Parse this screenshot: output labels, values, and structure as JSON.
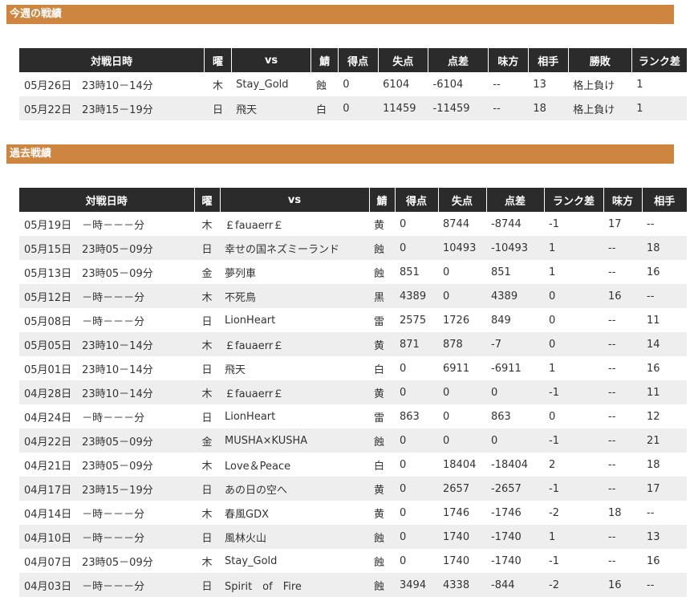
{
  "this_week": {
    "title": "今週の戦績",
    "headers": [
      "対戦日時",
      "曜",
      "vs",
      "鯖",
      "得点",
      "失点",
      "点差",
      "味方",
      "相手",
      "勝敗",
      "ランク差"
    ],
    "rows": [
      [
        "05月26日　23時10－14分",
        "木",
        "Stay_Gold",
        "蝕",
        "0",
        "6104",
        "-6104",
        "--",
        "13",
        "格上負け",
        "1"
      ],
      [
        "05月22日　23時15－19分",
        "日",
        "飛天",
        "白",
        "0",
        "11459",
        "-11459",
        "--",
        "18",
        "格上負け",
        "1"
      ]
    ]
  },
  "past": {
    "title": "過去戦績",
    "headers": [
      "対戦日時",
      "曜",
      "vs",
      "鯖",
      "得点",
      "失点",
      "点差",
      "ランク差",
      "味方",
      "相手"
    ],
    "rows": [
      [
        "05月19日　－時－－－分",
        "木",
        "￡fauaerr￡",
        "黄",
        "0",
        "8744",
        "-8744",
        "-1",
        "17",
        "--"
      ],
      [
        "05月15日　23時05－09分",
        "日",
        "幸せの国ネズミーランド",
        "蝕",
        "0",
        "10493",
        "-10493",
        "1",
        "--",
        "18"
      ],
      [
        "05月13日　23時05－09分",
        "金",
        "夢列車",
        "蝕",
        "851",
        "0",
        "851",
        "1",
        "--",
        "16"
      ],
      [
        "05月12日　－時－－－分",
        "木",
        "不死鳥",
        "黒",
        "4389",
        "0",
        "4389",
        "0",
        "16",
        "--"
      ],
      [
        "05月08日　－時－－－分",
        "日",
        "LionHeart",
        "雷",
        "2575",
        "1726",
        "849",
        "0",
        "--",
        "11"
      ],
      [
        "05月05日　23時10－14分",
        "木",
        "￡fauaerr￡",
        "黄",
        "871",
        "878",
        "-7",
        "0",
        "--",
        "14"
      ],
      [
        "05月01日　23時10－14分",
        "日",
        "飛天",
        "白",
        "0",
        "6911",
        "-6911",
        "1",
        "--",
        "16"
      ],
      [
        "04月28日　23時10－14分",
        "木",
        "￡fauaerr￡",
        "黄",
        "0",
        "0",
        "0",
        "-1",
        "--",
        "11"
      ],
      [
        "04月24日　－時－－－分",
        "日",
        "LionHeart",
        "雷",
        "863",
        "0",
        "863",
        "0",
        "--",
        "12"
      ],
      [
        "04月22日　23時05－09分",
        "金",
        "MUSHA×KUSHA",
        "蝕",
        "0",
        "0",
        "0",
        "-1",
        "--",
        "21"
      ],
      [
        "04月21日　23時05－09分",
        "木",
        "Love＆Peace",
        "白",
        "0",
        "18404",
        "-18404",
        "2",
        "--",
        "18"
      ],
      [
        "04月17日　23時15－19分",
        "日",
        "あの日の空へ",
        "黄",
        "0",
        "2657",
        "-2657",
        "-1",
        "--",
        "17"
      ],
      [
        "04月14日　－時－－－分",
        "木",
        "春風GDX",
        "黄",
        "0",
        "1746",
        "-1746",
        "-2",
        "18",
        "--"
      ],
      [
        "04月10日　－時－－－分",
        "日",
        "風林火山",
        "蝕",
        "0",
        "1740",
        "-1740",
        "1",
        "--",
        "13"
      ],
      [
        "04月07日　23時05－09分",
        "木",
        "Stay_Gold",
        "蝕",
        "0",
        "1740",
        "-1740",
        "-1",
        "--",
        "16"
      ],
      [
        "04月03日　－時－－－分",
        "日",
        "Spirit　of　Fire",
        "蝕",
        "3494",
        "4338",
        "-844",
        "-2",
        "16",
        "--"
      ]
    ]
  }
}
